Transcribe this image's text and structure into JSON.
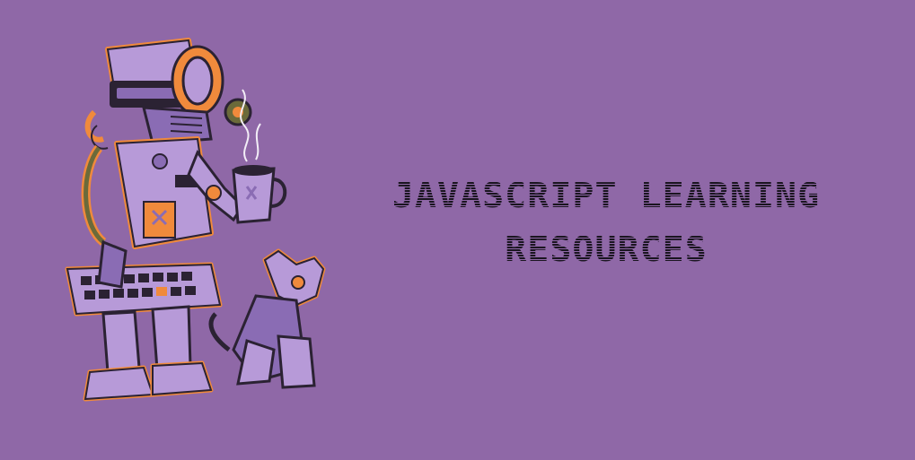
{
  "banner": {
    "background_color": "#8f68a7",
    "title_line_1": "JAVASCRIPT LEARNING",
    "title_line_2": "RESOURCES",
    "title_color": "#1a1520"
  },
  "illustration": {
    "subject": "robot-holding-keyboard-and-coffee-mug-with-robot-dog",
    "colors": {
      "body": "#b79ad8",
      "body_shade": "#8a6cb4",
      "accent": "#f08a3c",
      "dark": "#2b2233",
      "olive": "#6b6a3a"
    }
  }
}
